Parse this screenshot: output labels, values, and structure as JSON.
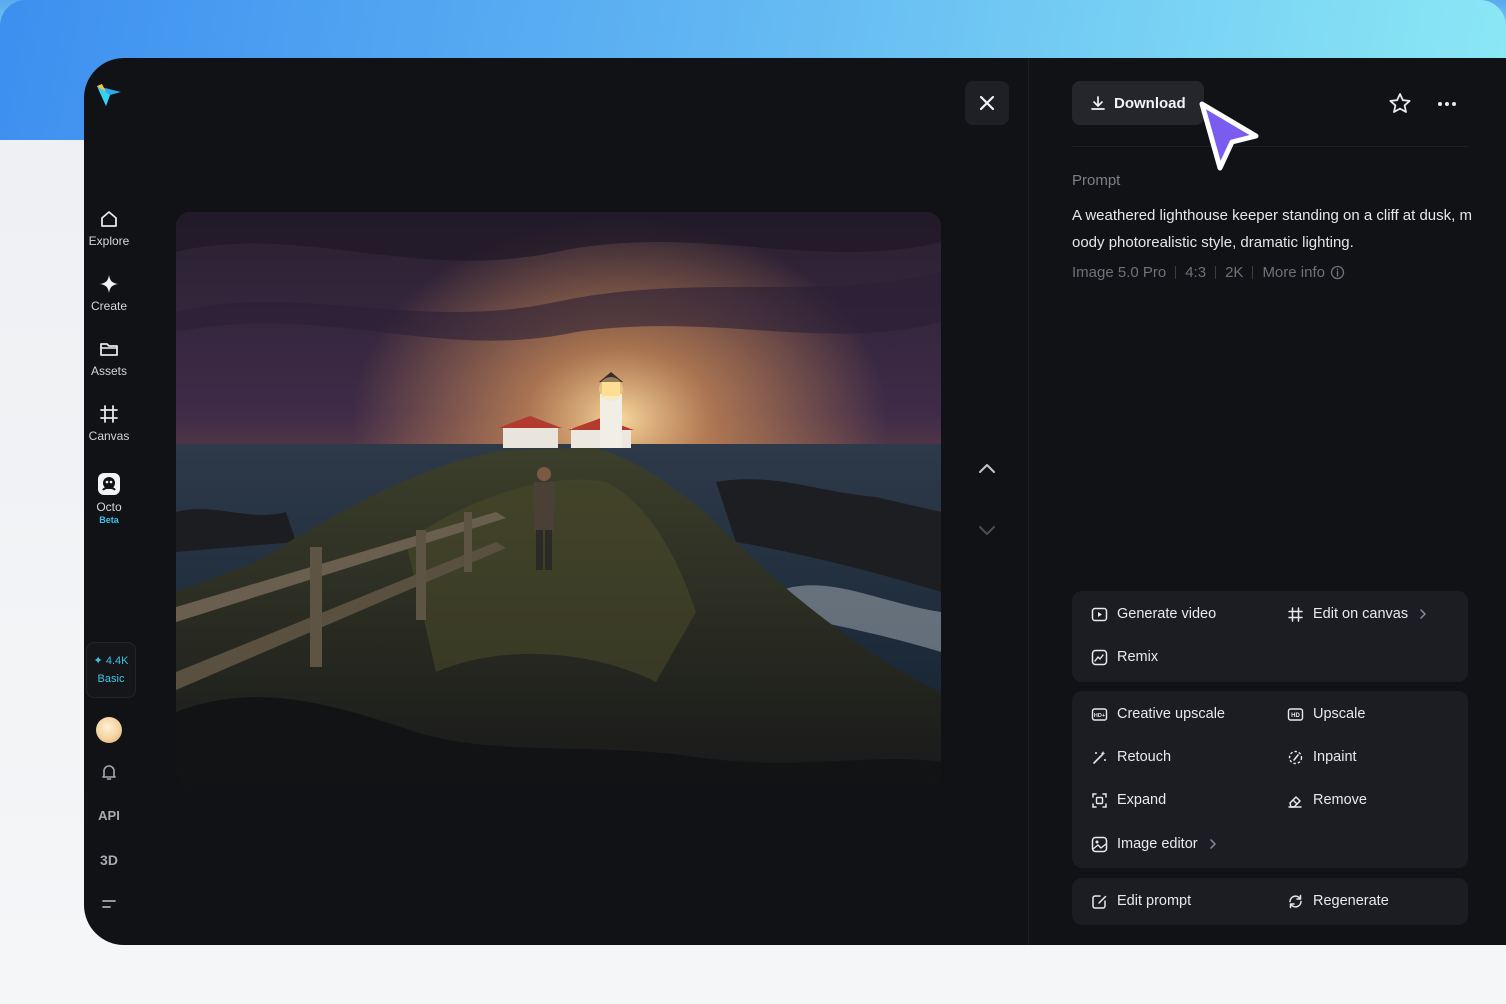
{
  "sidebar": {
    "nav": [
      {
        "label": "Explore",
        "icon": "home-icon"
      },
      {
        "label": "Create",
        "icon": "sparkle-icon"
      },
      {
        "label": "Assets",
        "icon": "folder-icon"
      },
      {
        "label": "Canvas",
        "icon": "canvas-icon"
      },
      {
        "label": "Octo",
        "icon": "octo-icon",
        "badge": "Beta"
      }
    ],
    "credits": {
      "amount": "✦ 4.4K",
      "plan": "Basic"
    },
    "api_label": "API",
    "threed_label": "3D"
  },
  "header": {
    "download_label": "Download"
  },
  "prompt": {
    "label": "Prompt",
    "text": "A weathered lighthouse keeper standing on a cliff at dusk, moody photorealistic style, dramatic lighting.",
    "model": "Image 5.0 Pro",
    "ratio": "4:3",
    "resolution": "2K",
    "more_info": "More info"
  },
  "actions": {
    "generate_video": "Generate video",
    "edit_on_canvas": "Edit on canvas",
    "remix": "Remix",
    "creative_upscale": "Creative upscale",
    "upscale": "Upscale",
    "retouch": "Retouch",
    "inpaint": "Inpaint",
    "expand": "Expand",
    "remove": "Remove",
    "image_editor": "Image editor",
    "edit_prompt": "Edit prompt",
    "regenerate": "Regenerate"
  },
  "colors": {
    "accent": "#3ec3e8",
    "panel": "#111215",
    "card": "#1c1d22",
    "cursor": "#7b5cf0"
  }
}
